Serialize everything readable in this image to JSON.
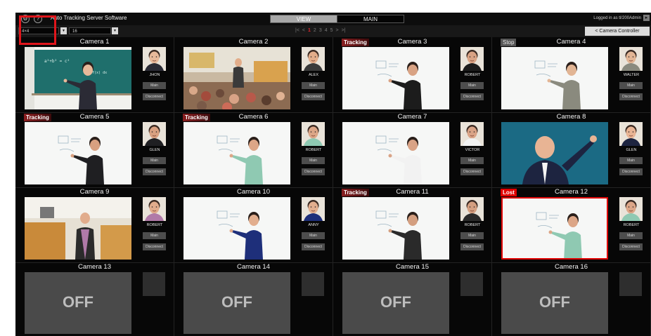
{
  "app": {
    "title": "Auto Tracking Server Software"
  },
  "header": {
    "tabs": [
      {
        "label": "VIEW",
        "active": true
      },
      {
        "label": "MAIN",
        "active": false
      }
    ],
    "login_text": "Logged in as tl/200Admin",
    "settings_icon": "gear-icon",
    "help_icon": "help-icon"
  },
  "toolbar": {
    "layout_value": "4×4",
    "count_value": "16",
    "pages": [
      "|<",
      "<",
      "1",
      "2",
      "3",
      "4",
      "5",
      ">",
      ">|"
    ],
    "current_page": "1",
    "camera_controller_label": "< Camera Controller"
  },
  "colors": {
    "tracking": "#8a1e20",
    "lost": "#e00000",
    "highlight": "#e0151b",
    "off_bg": "#4a4a4a"
  },
  "labels": {
    "main": "Main",
    "disconnect": "Disconnect",
    "off": "OFF"
  },
  "cameras": [
    {
      "title": "Camera 1",
      "status": "",
      "person": "JHON",
      "scene": "blackboard",
      "shirt": "#2b2b35",
      "skin": "#e8b99a"
    },
    {
      "title": "Camera 2",
      "status": "",
      "person": "ALEX",
      "scene": "lecture",
      "shirt": "#3a3a3a",
      "skin": "#e2ad8a"
    },
    {
      "title": "Camera 3",
      "status": "Tracking",
      "person": "ROBERT",
      "scene": "whiteboard",
      "shirt": "#1c1c1c",
      "skin": "#d9a384"
    },
    {
      "title": "Camera 4",
      "status": "Stop",
      "person": "WALTER",
      "scene": "whiteboard",
      "shirt": "#8a8a7e",
      "skin": "#e2b594"
    },
    {
      "title": "Camera 5",
      "status": "Tracking",
      "person": "GLEN",
      "scene": "whiteboard",
      "shirt": "#1f1f22",
      "skin": "#d8a080"
    },
    {
      "title": "Camera 6",
      "status": "Tracking",
      "person": "ROBERT",
      "scene": "whiteboard",
      "shirt": "#8fc9b2",
      "skin": "#dca687"
    },
    {
      "title": "Camera 7",
      "status": "",
      "person": "VICTOR",
      "scene": "whiteboard",
      "shirt": "#f2f2f2",
      "skin": "#d9a386"
    },
    {
      "title": "Camera 8",
      "status": "",
      "person": "GLEN",
      "scene": "teal",
      "shirt": "#1d2440",
      "skin": "#e8b494"
    },
    {
      "title": "Camera 9",
      "status": "",
      "person": "ROBERT",
      "scene": "classroom",
      "shirt": "#b07aa8",
      "skin": "#e1ac8c"
    },
    {
      "title": "Camera 10",
      "status": "",
      "person": "ANNY",
      "scene": "whiteboard",
      "shirt": "#1e2f7a",
      "skin": "#e2ae8e"
    },
    {
      "title": "Camera 11",
      "status": "Tracking",
      "person": "ROBERT",
      "scene": "whiteboard",
      "shirt": "#2a2a2a",
      "skin": "#d49f80"
    },
    {
      "title": "Camera 12",
      "status": "Lost",
      "person": "ROBERT",
      "scene": "whiteboard",
      "shirt": "#8fc9b2",
      "skin": "#dca687"
    },
    {
      "title": "Camera 13",
      "status": "",
      "off": true
    },
    {
      "title": "Camera 14",
      "status": "",
      "off": true
    },
    {
      "title": "Camera 15",
      "status": "",
      "off": true
    },
    {
      "title": "Camera 16",
      "status": "",
      "off": true
    }
  ]
}
